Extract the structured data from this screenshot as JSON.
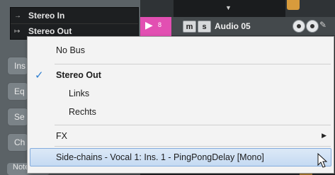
{
  "routing": {
    "input_label": "Stereo In",
    "output_label": "Stereo Out"
  },
  "side_buttons": [
    "Ins",
    "Eq",
    "Se",
    "Ch"
  ],
  "notepad_label": "Notepad",
  "track": {
    "number": "8",
    "mute_label": "m",
    "solo_label": "s",
    "name": "Audio 05"
  },
  "menu": {
    "no_bus": "No Bus",
    "stereo_out": "Stereo Out",
    "links": "Links",
    "rechts": "Rechts",
    "fx": "FX",
    "side_chain": "Side-chains - Vocal 1: Ins. 1 - PingPongDelay [Mono]"
  },
  "colors": {
    "track_color": "#e24fb2",
    "check_color": "#2f7fd1",
    "highlight": "#c5daf2"
  }
}
